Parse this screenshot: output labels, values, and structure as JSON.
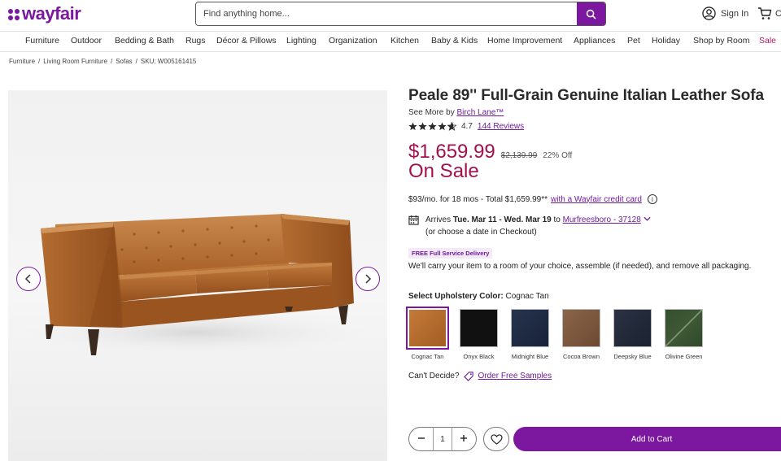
{
  "header": {
    "logo_text": "wayfair",
    "search_placeholder": "Find anything home...",
    "sign_in": "Sign In",
    "cart_label": "C"
  },
  "nav": {
    "items": [
      "Furniture",
      "Outdoor",
      "Bedding & Bath",
      "Rugs",
      "Décor & Pillows",
      "Lighting",
      "Organization",
      "Kitchen",
      "Baby & Kids",
      "Home Improvement",
      "Appliances",
      "Pet",
      "Holiday",
      "Shop by Room",
      "Sale"
    ]
  },
  "breadcrumb": {
    "items": [
      "Furniture",
      "Living Room Furniture",
      "Sofas"
    ],
    "sku": "SKU: W005161415"
  },
  "product": {
    "title": "Peale 89'' Full-Grain Genuine Italian Leather Sofa",
    "see_more_prefix": "See More by",
    "brand": "Birch Lane™",
    "rating": "4.7",
    "rating_fraction": 0.94,
    "reviews": "144 Reviews",
    "price": "$1,659.99",
    "old_price": "$2,139.99",
    "discount": "22% Off",
    "sale_label": "On Sale",
    "finance_text": "$93/mo. for 18 mos - Total $1,659.99**",
    "finance_link": "with a Wayfair credit card",
    "arrives_prefix": "Arrives",
    "arrives_dates": "Tue. Mar 11 - Wed. Mar 19",
    "arrives_to": "to",
    "location": "Murfreesboro - 37128",
    "arrives_note": "(or choose a date in Checkout)",
    "delivery_badge": "FREE Full Service Delivery",
    "delivery_text": "We'll carry your item to a room of your choice, assemble (if needed), and remove all packaging.",
    "color_prompt": "Select Upholstery Color:",
    "selected_color": "Cognac Tan",
    "swatches": [
      {
        "name": "Cognac Tan",
        "color": "#b86a2c"
      },
      {
        "name": "Onyx Black",
        "color": "#111111"
      },
      {
        "name": "Midnight Blue",
        "color": "#1e2a3f"
      },
      {
        "name": "Cocoa Brown",
        "color": "#7d5a41"
      },
      {
        "name": "Deepsky Blue",
        "color": "#222a38"
      },
      {
        "name": "Olivine Green",
        "color": "#3e5535"
      }
    ],
    "cant_decide": "Can't Decide?",
    "samples_link": "Order Free Samples",
    "quantity": "1",
    "add_to_cart": "Add to Cart"
  },
  "colors": {
    "brand_purple": "#7b189f",
    "sale_red": "#a3104e"
  }
}
